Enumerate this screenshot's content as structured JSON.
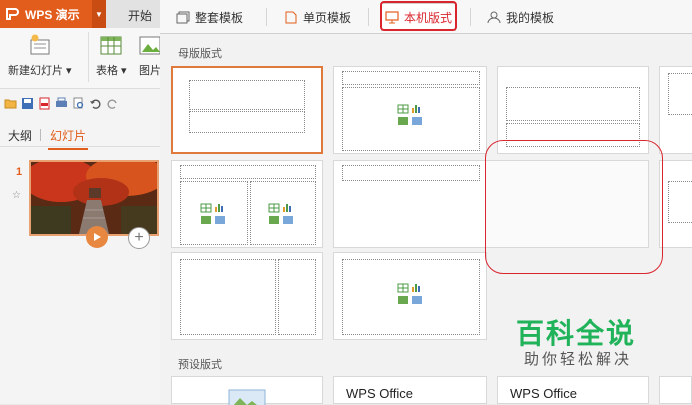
{
  "app": {
    "title": "WPS 演示",
    "tab_start": "开始",
    "ribbon": {
      "new_slide": "新建幻灯片",
      "table": "表格",
      "picture": "图片"
    },
    "panel_tabs": {
      "outline": "大纲",
      "slides": "幻灯片"
    },
    "slide_number": "1"
  },
  "dialog": {
    "tabs": [
      {
        "label": "整套模板",
        "icon": "template-set-icon"
      },
      {
        "label": "单页模板",
        "icon": "page-icon"
      },
      {
        "label": "本机版式",
        "icon": "monitor-icon",
        "active": true
      },
      {
        "label": "我的模板",
        "icon": "user-icon"
      }
    ],
    "section_master": "母版版式",
    "section_preset": "预设版式",
    "presets": [
      "WPS Office",
      "WPS Office"
    ]
  },
  "watermark": {
    "title": "百科全说",
    "subtitle": "助你轻松解决"
  },
  "colors": {
    "brand": "#e25c1b",
    "highlight": "#d9262d",
    "watermark": "#21b35a"
  }
}
